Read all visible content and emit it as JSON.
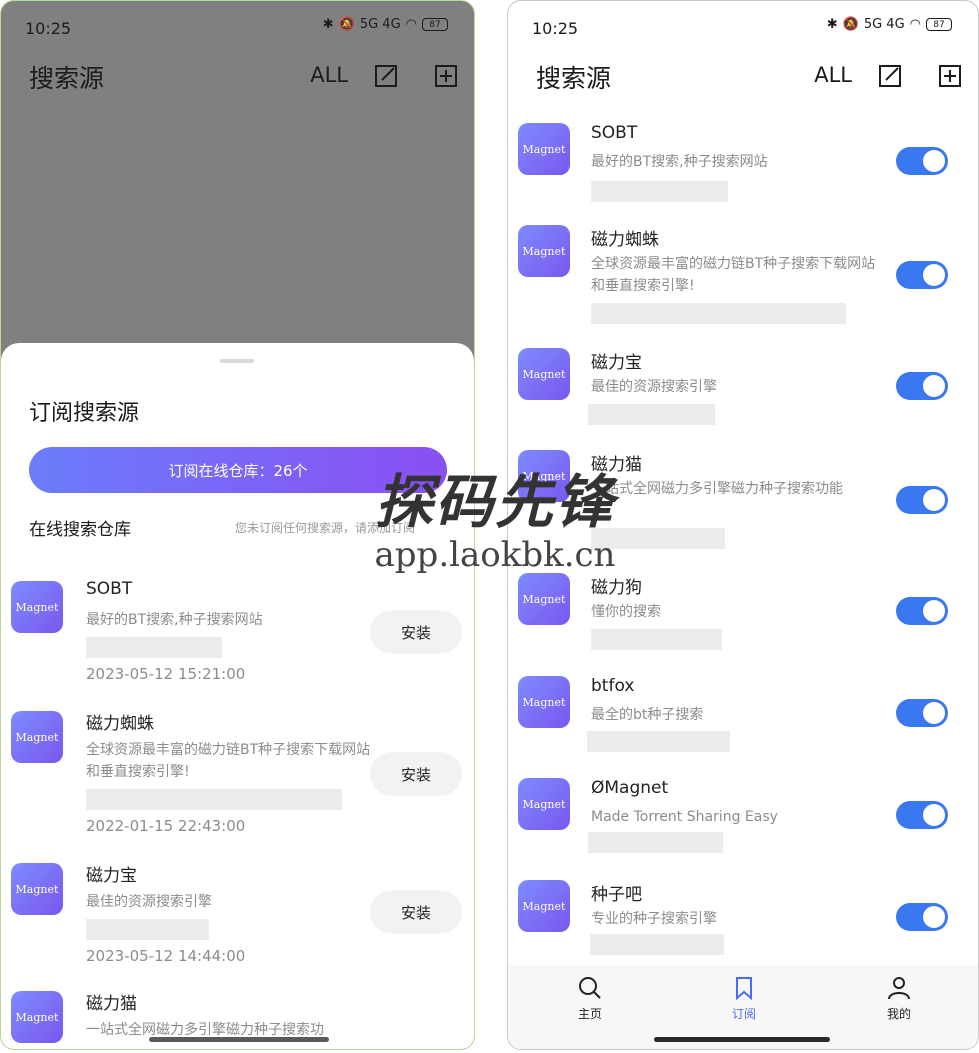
{
  "status": {
    "time": "10:25",
    "battery": "87",
    "network": "5G 4G"
  },
  "appbar": {
    "title": "搜索源",
    "all_label": "ALL"
  },
  "sheet": {
    "title": "订阅搜索源",
    "subscribe_label": "订阅在线仓库：26个",
    "repo_label": "在线搜索仓库",
    "repo_hint": "您未订阅任何搜索源，请添加订阅"
  },
  "logo_text": "Magnet",
  "install_label": "安装",
  "left_items": [
    {
      "name": "SOBT",
      "desc": "最好的BT搜索,种子搜索网站",
      "date": "2023-05-12 15:21:00"
    },
    {
      "name": "磁力蜘蛛",
      "desc": "全球资源最丰富的磁力链BT种子搜索下载网站和垂直搜索引擎!",
      "date": "2022-01-15 22:43:00"
    },
    {
      "name": "磁力宝",
      "desc": "最佳的资源搜索引擎",
      "date": "2023-05-12 14:44:00"
    },
    {
      "name": "磁力猫",
      "desc": "一站式全网磁力多引擎磁力种子搜索功"
    }
  ],
  "right_items": [
    {
      "name": "SOBT",
      "desc": "最好的BT搜索,种子搜索网站"
    },
    {
      "name": "磁力蜘蛛",
      "desc": "全球资源最丰富的磁力链BT种子搜索下载网站和垂直搜索引擎!"
    },
    {
      "name": "磁力宝",
      "desc": "最佳的资源搜索引擎"
    },
    {
      "name": "磁力猫",
      "desc": "一站式全网磁力多引擎磁力种子搜索功能"
    },
    {
      "name": "磁力狗",
      "desc": "懂你的搜索"
    },
    {
      "name": "btfox",
      "desc": "最全的bt种子搜索"
    },
    {
      "name": "ØMagnet",
      "desc": "Made Torrent Sharing  Easy"
    },
    {
      "name": "种子吧",
      "desc": "专业的种子搜索引擎"
    }
  ],
  "nav": {
    "home": "主页",
    "subscribe": "订阅",
    "mine": "我的"
  },
  "watermark": {
    "title": "探码先锋",
    "url": "app.laokbk.cn"
  },
  "colors": {
    "accent": "#3a78f2",
    "gradient_start": "#6b7dfb",
    "gradient_end": "#8a4ff2"
  }
}
